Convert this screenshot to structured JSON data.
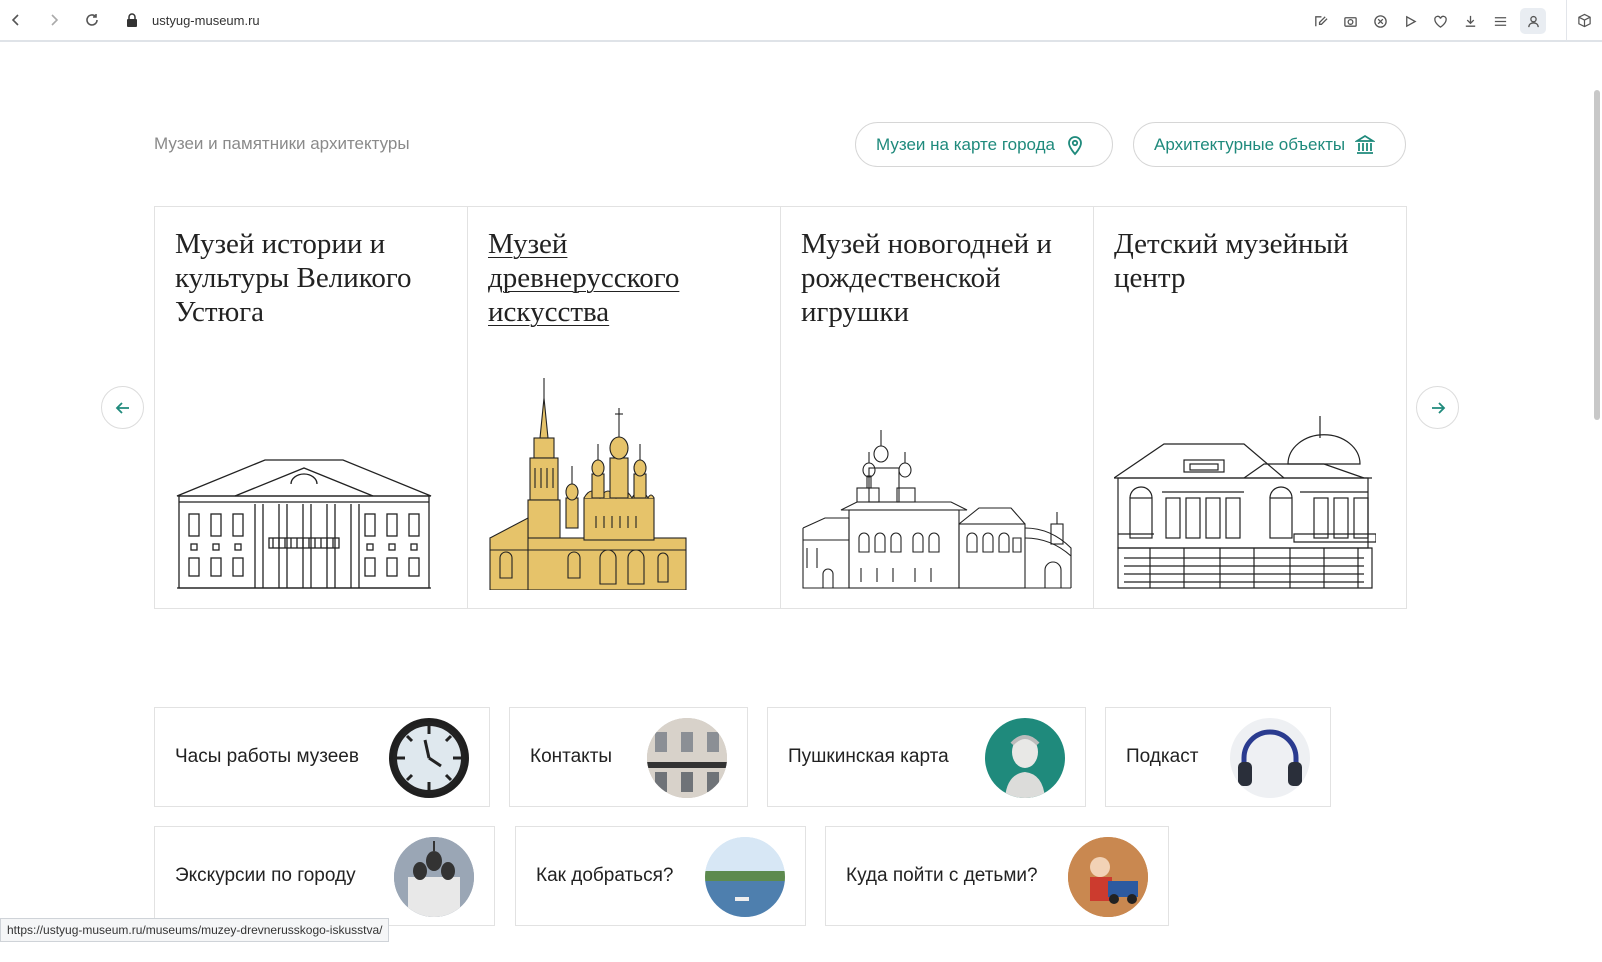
{
  "browser": {
    "url": "ustyug-museum.ru",
    "status_url": "https://ustyug-museum.ru/museums/muzey-drevnerusskogo-iskusstva/"
  },
  "section": {
    "title": "Музеи и памятники архитектуры",
    "map_button": "Музеи на карте города",
    "arch_button": "Архитектурные объекты"
  },
  "cards": [
    {
      "title": "Музей истории и культуры Великого Устюга"
    },
    {
      "title": "Музей древнерусского искусства"
    },
    {
      "title": "Музей новогодней и рождественской игрушки"
    },
    {
      "title": "Детский музейный центр"
    }
  ],
  "tiles": [
    {
      "label": "Часы работы музеев"
    },
    {
      "label": "Контакты"
    },
    {
      "label": "Пушкинская карта"
    },
    {
      "label": "Подкаст"
    },
    {
      "label": "Экскурсии по городу"
    },
    {
      "label": "Как добраться?"
    },
    {
      "label": "Куда пойти с детьми?"
    }
  ],
  "colors": {
    "accent": "#1f8a7c",
    "gold": "#e6c36a"
  }
}
